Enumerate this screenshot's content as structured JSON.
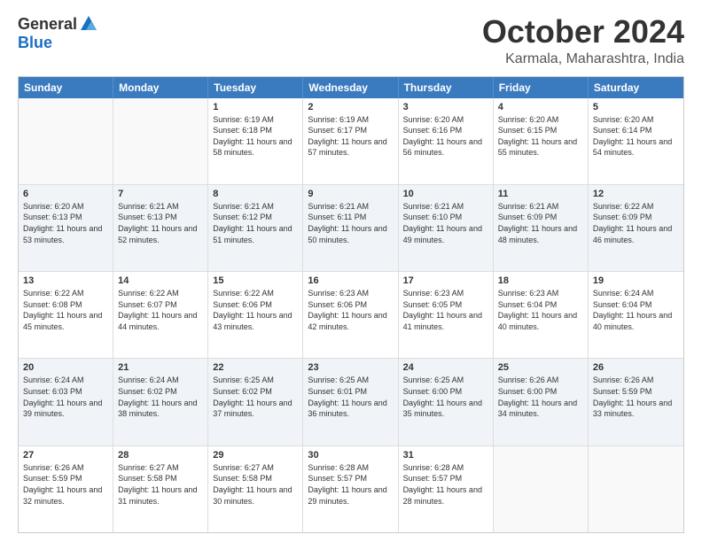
{
  "logo": {
    "general": "General",
    "blue": "Blue"
  },
  "title": "October 2024",
  "location": "Karmala, Maharashtra, India",
  "headers": [
    "Sunday",
    "Monday",
    "Tuesday",
    "Wednesday",
    "Thursday",
    "Friday",
    "Saturday"
  ],
  "weeks": [
    [
      {
        "day": "",
        "sunrise": "",
        "sunset": "",
        "daylight": "",
        "empty": true
      },
      {
        "day": "",
        "sunrise": "",
        "sunset": "",
        "daylight": "",
        "empty": true
      },
      {
        "day": "1",
        "sunrise": "Sunrise: 6:19 AM",
        "sunset": "Sunset: 6:18 PM",
        "daylight": "Daylight: 11 hours and 58 minutes.",
        "empty": false
      },
      {
        "day": "2",
        "sunrise": "Sunrise: 6:19 AM",
        "sunset": "Sunset: 6:17 PM",
        "daylight": "Daylight: 11 hours and 57 minutes.",
        "empty": false
      },
      {
        "day": "3",
        "sunrise": "Sunrise: 6:20 AM",
        "sunset": "Sunset: 6:16 PM",
        "daylight": "Daylight: 11 hours and 56 minutes.",
        "empty": false
      },
      {
        "day": "4",
        "sunrise": "Sunrise: 6:20 AM",
        "sunset": "Sunset: 6:15 PM",
        "daylight": "Daylight: 11 hours and 55 minutes.",
        "empty": false
      },
      {
        "day": "5",
        "sunrise": "Sunrise: 6:20 AM",
        "sunset": "Sunset: 6:14 PM",
        "daylight": "Daylight: 11 hours and 54 minutes.",
        "empty": false
      }
    ],
    [
      {
        "day": "6",
        "sunrise": "Sunrise: 6:20 AM",
        "sunset": "Sunset: 6:13 PM",
        "daylight": "Daylight: 11 hours and 53 minutes.",
        "empty": false
      },
      {
        "day": "7",
        "sunrise": "Sunrise: 6:21 AM",
        "sunset": "Sunset: 6:13 PM",
        "daylight": "Daylight: 11 hours and 52 minutes.",
        "empty": false
      },
      {
        "day": "8",
        "sunrise": "Sunrise: 6:21 AM",
        "sunset": "Sunset: 6:12 PM",
        "daylight": "Daylight: 11 hours and 51 minutes.",
        "empty": false
      },
      {
        "day": "9",
        "sunrise": "Sunrise: 6:21 AM",
        "sunset": "Sunset: 6:11 PM",
        "daylight": "Daylight: 11 hours and 50 minutes.",
        "empty": false
      },
      {
        "day": "10",
        "sunrise": "Sunrise: 6:21 AM",
        "sunset": "Sunset: 6:10 PM",
        "daylight": "Daylight: 11 hours and 49 minutes.",
        "empty": false
      },
      {
        "day": "11",
        "sunrise": "Sunrise: 6:21 AM",
        "sunset": "Sunset: 6:09 PM",
        "daylight": "Daylight: 11 hours and 48 minutes.",
        "empty": false
      },
      {
        "day": "12",
        "sunrise": "Sunrise: 6:22 AM",
        "sunset": "Sunset: 6:09 PM",
        "daylight": "Daylight: 11 hours and 46 minutes.",
        "empty": false
      }
    ],
    [
      {
        "day": "13",
        "sunrise": "Sunrise: 6:22 AM",
        "sunset": "Sunset: 6:08 PM",
        "daylight": "Daylight: 11 hours and 45 minutes.",
        "empty": false
      },
      {
        "day": "14",
        "sunrise": "Sunrise: 6:22 AM",
        "sunset": "Sunset: 6:07 PM",
        "daylight": "Daylight: 11 hours and 44 minutes.",
        "empty": false
      },
      {
        "day": "15",
        "sunrise": "Sunrise: 6:22 AM",
        "sunset": "Sunset: 6:06 PM",
        "daylight": "Daylight: 11 hours and 43 minutes.",
        "empty": false
      },
      {
        "day": "16",
        "sunrise": "Sunrise: 6:23 AM",
        "sunset": "Sunset: 6:06 PM",
        "daylight": "Daylight: 11 hours and 42 minutes.",
        "empty": false
      },
      {
        "day": "17",
        "sunrise": "Sunrise: 6:23 AM",
        "sunset": "Sunset: 6:05 PM",
        "daylight": "Daylight: 11 hours and 41 minutes.",
        "empty": false
      },
      {
        "day": "18",
        "sunrise": "Sunrise: 6:23 AM",
        "sunset": "Sunset: 6:04 PM",
        "daylight": "Daylight: 11 hours and 40 minutes.",
        "empty": false
      },
      {
        "day": "19",
        "sunrise": "Sunrise: 6:24 AM",
        "sunset": "Sunset: 6:04 PM",
        "daylight": "Daylight: 11 hours and 40 minutes.",
        "empty": false
      }
    ],
    [
      {
        "day": "20",
        "sunrise": "Sunrise: 6:24 AM",
        "sunset": "Sunset: 6:03 PM",
        "daylight": "Daylight: 11 hours and 39 minutes.",
        "empty": false
      },
      {
        "day": "21",
        "sunrise": "Sunrise: 6:24 AM",
        "sunset": "Sunset: 6:02 PM",
        "daylight": "Daylight: 11 hours and 38 minutes.",
        "empty": false
      },
      {
        "day": "22",
        "sunrise": "Sunrise: 6:25 AM",
        "sunset": "Sunset: 6:02 PM",
        "daylight": "Daylight: 11 hours and 37 minutes.",
        "empty": false
      },
      {
        "day": "23",
        "sunrise": "Sunrise: 6:25 AM",
        "sunset": "Sunset: 6:01 PM",
        "daylight": "Daylight: 11 hours and 36 minutes.",
        "empty": false
      },
      {
        "day": "24",
        "sunrise": "Sunrise: 6:25 AM",
        "sunset": "Sunset: 6:00 PM",
        "daylight": "Daylight: 11 hours and 35 minutes.",
        "empty": false
      },
      {
        "day": "25",
        "sunrise": "Sunrise: 6:26 AM",
        "sunset": "Sunset: 6:00 PM",
        "daylight": "Daylight: 11 hours and 34 minutes.",
        "empty": false
      },
      {
        "day": "26",
        "sunrise": "Sunrise: 6:26 AM",
        "sunset": "Sunset: 5:59 PM",
        "daylight": "Daylight: 11 hours and 33 minutes.",
        "empty": false
      }
    ],
    [
      {
        "day": "27",
        "sunrise": "Sunrise: 6:26 AM",
        "sunset": "Sunset: 5:59 PM",
        "daylight": "Daylight: 11 hours and 32 minutes.",
        "empty": false
      },
      {
        "day": "28",
        "sunrise": "Sunrise: 6:27 AM",
        "sunset": "Sunset: 5:58 PM",
        "daylight": "Daylight: 11 hours and 31 minutes.",
        "empty": false
      },
      {
        "day": "29",
        "sunrise": "Sunrise: 6:27 AM",
        "sunset": "Sunset: 5:58 PM",
        "daylight": "Daylight: 11 hours and 30 minutes.",
        "empty": false
      },
      {
        "day": "30",
        "sunrise": "Sunrise: 6:28 AM",
        "sunset": "Sunset: 5:57 PM",
        "daylight": "Daylight: 11 hours and 29 minutes.",
        "empty": false
      },
      {
        "day": "31",
        "sunrise": "Sunrise: 6:28 AM",
        "sunset": "Sunset: 5:57 PM",
        "daylight": "Daylight: 11 hours and 28 minutes.",
        "empty": false
      },
      {
        "day": "",
        "sunrise": "",
        "sunset": "",
        "daylight": "",
        "empty": true
      },
      {
        "day": "",
        "sunrise": "",
        "sunset": "",
        "daylight": "",
        "empty": true
      }
    ]
  ]
}
